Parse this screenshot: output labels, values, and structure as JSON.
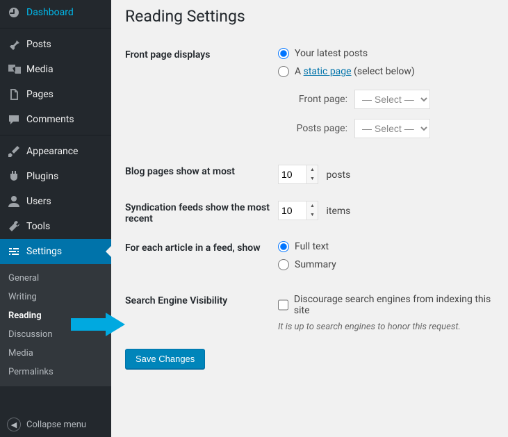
{
  "sidebar": {
    "items": [
      {
        "label": "Dashboard",
        "icon": "dashboard"
      },
      {
        "label": "Posts",
        "icon": "pin"
      },
      {
        "label": "Media",
        "icon": "media"
      },
      {
        "label": "Pages",
        "icon": "pages"
      },
      {
        "label": "Comments",
        "icon": "comment"
      },
      {
        "label": "Appearance",
        "icon": "brush"
      },
      {
        "label": "Plugins",
        "icon": "plug"
      },
      {
        "label": "Users",
        "icon": "user"
      },
      {
        "label": "Tools",
        "icon": "wrench"
      },
      {
        "label": "Settings",
        "icon": "sliders"
      }
    ],
    "submenu": [
      {
        "label": "General"
      },
      {
        "label": "Writing"
      },
      {
        "label": "Reading"
      },
      {
        "label": "Discussion"
      },
      {
        "label": "Media"
      },
      {
        "label": "Permalinks"
      }
    ],
    "collapse_label": "Collapse menu"
  },
  "page": {
    "title": "Reading Settings",
    "front_page": {
      "label": "Front page displays",
      "opt_latest": "Your latest posts",
      "opt_static_prefix": "A ",
      "opt_static_link": "static page",
      "opt_static_suffix": " (select below)",
      "front_label": "Front page:",
      "posts_label": "Posts page:",
      "select_placeholder": "— Select —"
    },
    "blog_pages": {
      "label": "Blog pages show at most",
      "value": "10",
      "unit": "posts"
    },
    "syndication": {
      "label": "Syndication feeds show the most recent",
      "value": "10",
      "unit": "items"
    },
    "feed_article": {
      "label": "For each article in a feed, show",
      "opt_full": "Full text",
      "opt_summary": "Summary"
    },
    "search_visibility": {
      "label": "Search Engine Visibility",
      "checkbox_label": "Discourage search engines from indexing this site",
      "desc": "It is up to search engines to honor this request."
    },
    "save_label": "Save Changes"
  },
  "colors": {
    "accent": "#0073aa",
    "arrow": "#00a9e0"
  }
}
